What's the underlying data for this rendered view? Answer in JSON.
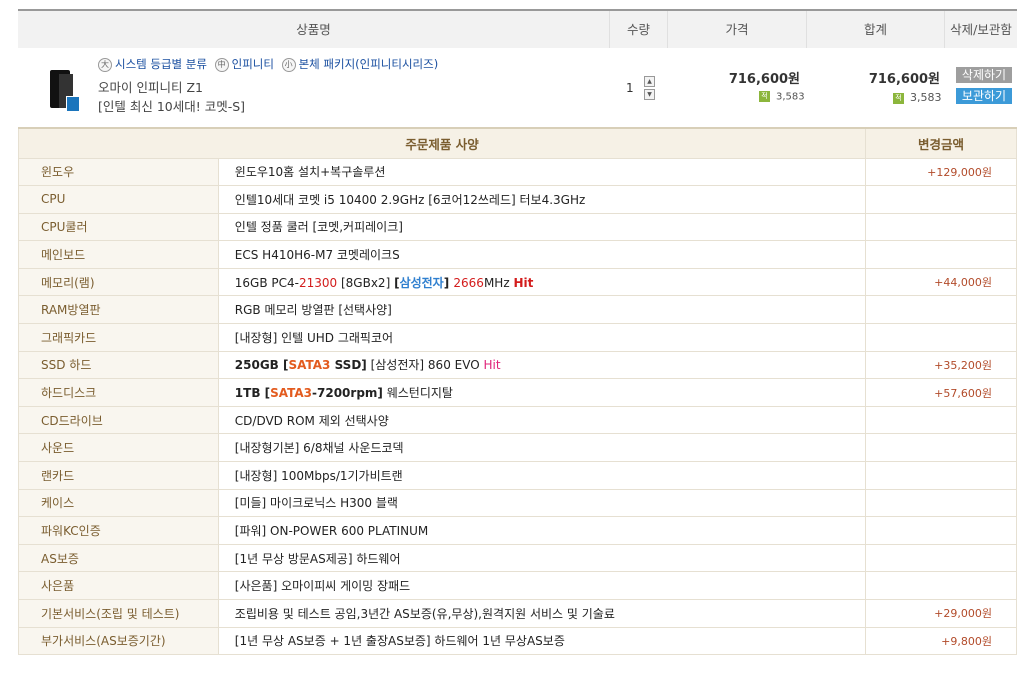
{
  "cart_header": {
    "name": "상품명",
    "qty": "수량",
    "price": "가격",
    "sum": "합계",
    "action": "삭제/보관함"
  },
  "product": {
    "tags": [
      {
        "icon": "大",
        "label": "시스템 등급별 분류"
      },
      {
        "icon": "中",
        "label": "인피니티"
      },
      {
        "icon": "小",
        "label": "본체 패키지(인피니티시리즈)"
      }
    ],
    "name": "오마이 인피니티 Z1",
    "subtitle": "[인텔 최신 10세대! 코멧-S]",
    "qty": "1",
    "price": "716,600원",
    "price_points": "3,583",
    "sum": "716,600원",
    "sum_points": "3,583",
    "points_icon": "적",
    "delete_label": "삭제하기",
    "keep_label": "보관하기"
  },
  "spec_header": {
    "title": "주문제품 사양",
    "change": "변경금액"
  },
  "spec_rows": [
    {
      "label": "윈도우",
      "value": "윈도우10홈 설치+복구솔루션",
      "change": "+129,000원"
    },
    {
      "label": "CPU",
      "value": "인텔10세대 코멧 i5 10400 2.9GHz [6코어12쓰레드] 터보4.3GHz",
      "change": ""
    },
    {
      "label": "CPU쿨러",
      "value": "인텔 정품 쿨러 [코멧,커피레이크]",
      "change": ""
    },
    {
      "label": "메인보드",
      "value": "ECS H410H6-M7 코멧레이크S",
      "change": ""
    },
    {
      "label": "메모리(램)",
      "value_parts": [
        "16GB PC4-",
        "21300",
        " [8GBx2] ",
        "[",
        "삼성전자",
        "] ",
        "2666",
        "MHz ",
        "Hit"
      ],
      "change": "+44,000원"
    },
    {
      "label": "RAM방열판",
      "value": "RGB 메모리 방열판 [선택사양]",
      "change": ""
    },
    {
      "label": "그래픽카드",
      "value": "[내장형] 인텔 UHD 그래픽코어",
      "change": ""
    },
    {
      "label": "SSD 하드",
      "value_parts": [
        "250GB [",
        "SATA3",
        " SSD]",
        " [삼성전자] 860 EVO ",
        "Hit"
      ],
      "change": "+35,200원"
    },
    {
      "label": "하드디스크",
      "value_parts": [
        "1TB [",
        "SATA3",
        "-7200rpm]",
        " 웨스턴디지탈"
      ],
      "change": "+57,600원"
    },
    {
      "label": "CD드라이브",
      "value": "CD/DVD ROM 제외 선택사양",
      "change": ""
    },
    {
      "label": "사운드",
      "value": "[내장형기본] 6/8채널 사운드코덱",
      "change": ""
    },
    {
      "label": "랜카드",
      "value": "[내장형] 100Mbps/1기가비트랜",
      "change": ""
    },
    {
      "label": "케이스",
      "value": "[미들] 마이크로닉스 H300 블랙",
      "change": ""
    },
    {
      "label": "파워KC인증",
      "value": "[파워] ON-POWER 600 PLATINUM",
      "change": ""
    },
    {
      "label": "AS보증",
      "value": "[1년 무상 방문AS제공] 하드웨어",
      "change": ""
    },
    {
      "label": "사은품",
      "value": "[사은품] 오마이피씨 게이밍 장패드",
      "change": ""
    },
    {
      "label": "기본서비스(조립 및 테스트)",
      "value": "조립비용 및 테스트 공임,3년간 AS보증(유,무상),원격지원 서비스 및 기술료",
      "change": "+29,000원"
    },
    {
      "label": "부가서비스(AS보증기간)",
      "value": "[1년 무상 AS보증 + 1년 출장AS보증] 하드웨어 1년 무상AS보증",
      "change": "+9,800원"
    }
  ]
}
